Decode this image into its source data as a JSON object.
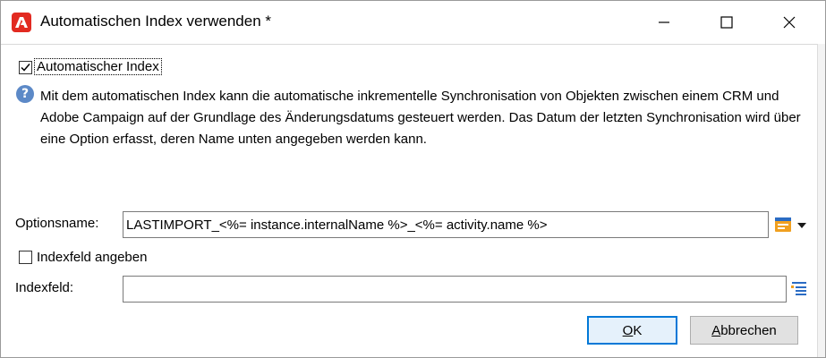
{
  "window": {
    "title": "Automatischen Index verwenden *",
    "app_icon": "adobe-campaign-icon",
    "controls": {
      "minimize_icon": "minimize-icon",
      "maximize_icon": "maximize-icon",
      "close_icon": "close-icon"
    }
  },
  "auto_index": {
    "label": "Automatischer Index",
    "checked": true
  },
  "info": {
    "icon": "question-icon",
    "text": "Mit dem automatischen Index kann die automatische inkrementelle Synchronisation von Objekten zwischen einem CRM und Adobe Campaign auf der Grundlage des Änderungsdatums gesteuert werden. Das Datum der letzten Synchronisation wird über eine Option erfasst, deren Name unten angegeben werden kann."
  },
  "option_name": {
    "label": "Optionsname:",
    "value": "LASTIMPORT_<%= instance.internalName %>_<%= activity.name %>",
    "edit_icon": "expression-editor-icon",
    "dropdown_icon": "chevron-down-icon"
  },
  "index_field_toggle": {
    "label": "Indexfeld angeben",
    "checked": false
  },
  "index_field": {
    "label": "Indexfeld:",
    "value": "",
    "edit_icon": "field-picker-icon"
  },
  "buttons": {
    "ok_mnemonic": "O",
    "ok_rest": "K",
    "cancel_mnemonic": "A",
    "cancel_rest": "bbrechen"
  },
  "colors": {
    "accent": "#0078d7",
    "adobe_red": "#e22a21",
    "info_blue": "#5c89c7",
    "editor_orange": "#f0a020"
  }
}
